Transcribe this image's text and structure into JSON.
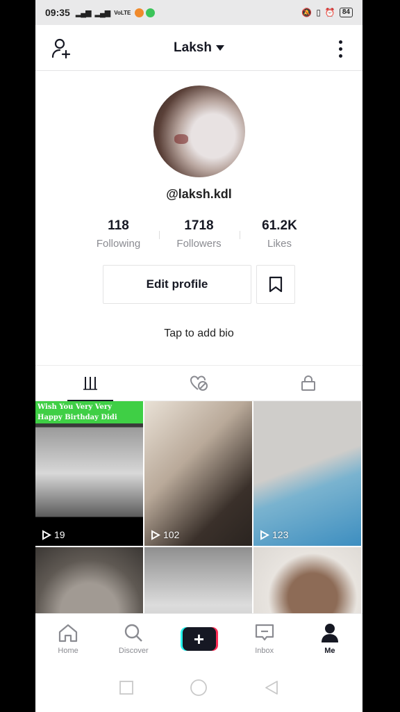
{
  "status_bar": {
    "time": "09:35",
    "network_label": "VoLTE",
    "battery": "84"
  },
  "header": {
    "title": "Laksh",
    "add_user_icon": "add-user-icon",
    "more_icon": "more-vertical-icon"
  },
  "profile": {
    "handle": "@laksh.kdl",
    "stats": [
      {
        "value": "118",
        "label": "Following"
      },
      {
        "value": "1718",
        "label": "Followers"
      },
      {
        "value": "61.2K",
        "label": "Likes"
      }
    ],
    "edit_button": "Edit profile",
    "bio_placeholder": "Tap to add bio"
  },
  "tabs": [
    {
      "icon": "videos-grid-icon",
      "active": true
    },
    {
      "icon": "liked-hidden-icon",
      "active": false
    },
    {
      "icon": "lock-icon",
      "active": false
    }
  ],
  "videos": [
    {
      "views": "19",
      "caption_line1": "Wish You Very Very",
      "caption_line2": "Happy Birthday Didi"
    },
    {
      "views": "102"
    },
    {
      "views": "123"
    },
    {
      "views": ""
    },
    {
      "views": ""
    },
    {
      "views": ""
    }
  ],
  "bottom_nav": [
    {
      "label": "Home",
      "icon": "home-icon"
    },
    {
      "label": "Discover",
      "icon": "search-icon"
    },
    {
      "label": "",
      "icon": "create-plus-icon"
    },
    {
      "label": "Inbox",
      "icon": "inbox-icon"
    },
    {
      "label": "Me",
      "icon": "profile-icon",
      "active": true
    }
  ],
  "colors": {
    "accent_cyan": "#25f4ee",
    "accent_red": "#fe2c55",
    "text_primary": "#161823",
    "text_secondary": "#8a8b91"
  }
}
